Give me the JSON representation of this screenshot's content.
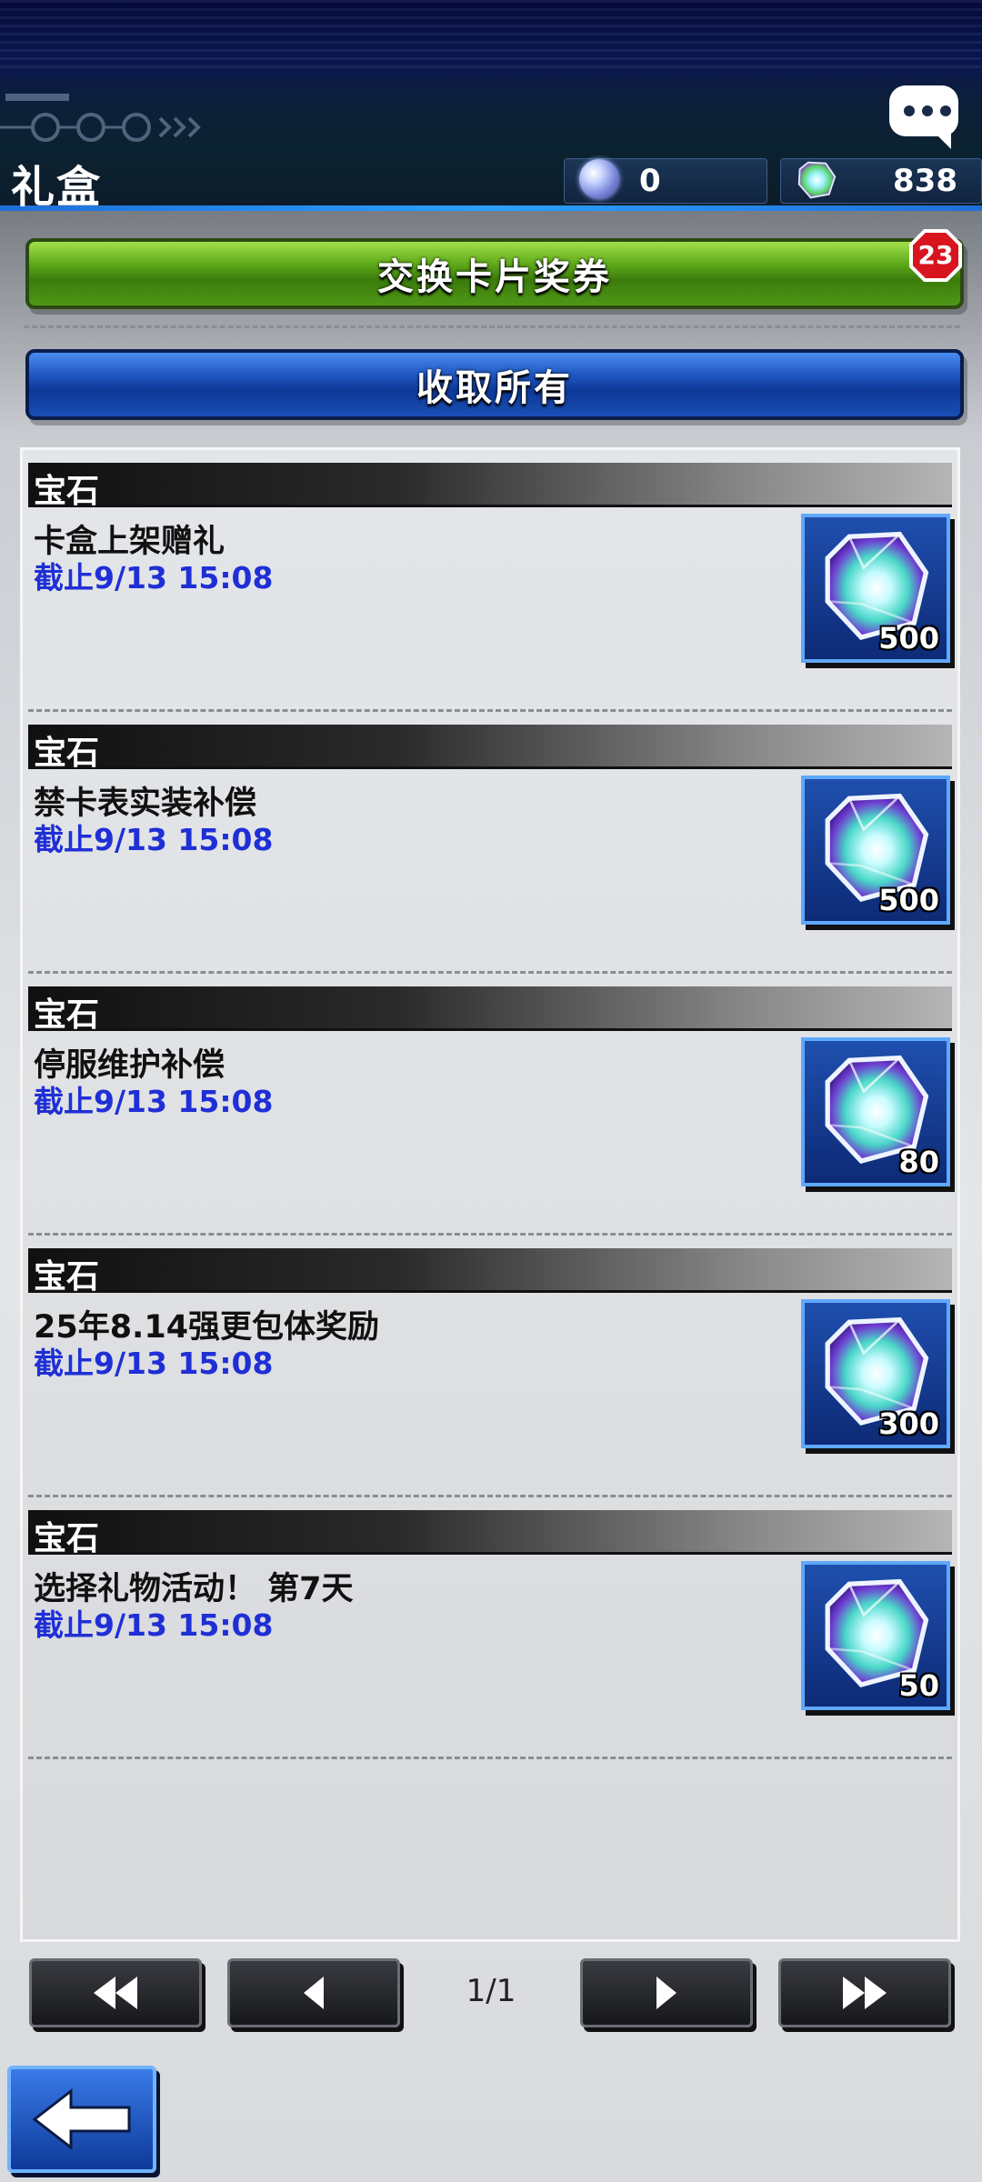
{
  "header": {
    "title": "礼盒",
    "currency_orb_value": "0",
    "currency_gem_value": "838",
    "chat_icon": "chat-bubble-icon"
  },
  "buttons": {
    "exchange_label": "交换卡片奖券",
    "exchange_badge": "23",
    "collect_all_label": "收取所有"
  },
  "gifts": [
    {
      "category": "宝石",
      "name": "卡盒上架赠礼",
      "deadline": "截止9/13 15:08",
      "qty": "500",
      "icon": "gem-icon"
    },
    {
      "category": "宝石",
      "name": "禁卡表实装补偿",
      "deadline": "截止9/13 15:08",
      "qty": "500",
      "icon": "gem-icon"
    },
    {
      "category": "宝石",
      "name": "停服维护补偿",
      "deadline": "截止9/13 15:08",
      "qty": "80",
      "icon": "gem-icon"
    },
    {
      "category": "宝石",
      "name": "25年8.14强更包体奖励",
      "deadline": "截止9/13 15:08",
      "qty": "300",
      "icon": "gem-icon"
    },
    {
      "category": "宝石",
      "name": "选择礼物活动！ 第7天",
      "deadline": "截止9/13 15:08",
      "qty": "50",
      "icon": "gem-icon"
    }
  ],
  "pagination": {
    "page_text": "1/1",
    "first_icon": "double-chevron-left-icon",
    "prev_icon": "chevron-left-icon",
    "next_icon": "chevron-right-icon",
    "last_icon": "double-chevron-right-icon"
  },
  "footer": {
    "back_icon": "back-arrow-icon"
  },
  "colors": {
    "green_button": "#4f9816",
    "blue_button": "#1b4fb5",
    "deadline_text": "#1f2fd6",
    "badge_red": "#d8141e"
  }
}
